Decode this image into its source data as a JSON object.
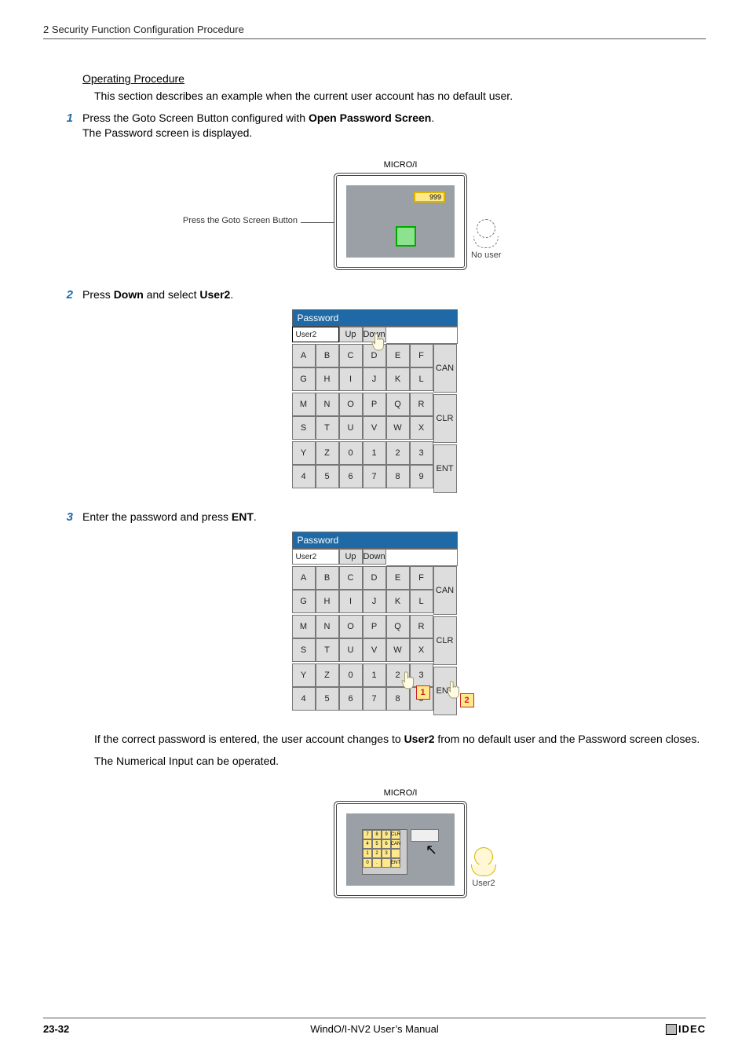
{
  "header": {
    "chapter_line": "2 Security Function Configuration Procedure"
  },
  "section": {
    "title": "Operating Procedure",
    "intro": "This section describes an example when the current user account has no default user."
  },
  "steps": {
    "s1": {
      "num": "1",
      "line1_a": "Press the Goto Screen Button configured with ",
      "line1_b": "Open Password Screen",
      "line1_c": ".",
      "line2": "The Password screen is displayed."
    },
    "s2": {
      "num": "2",
      "a": "Press ",
      "b": "Down",
      "c": " and select ",
      "d": "User2",
      "e": "."
    },
    "s3": {
      "num": "3",
      "a": "Enter the password and press ",
      "b": "ENT",
      "c": "."
    }
  },
  "fig1": {
    "device_label": "MICRO/I",
    "display_value": "999",
    "goto_caption": "Press the Goto Screen Button",
    "no_user_caption": "No user"
  },
  "keypad": {
    "title": "Password",
    "user_field": "User2",
    "up": "Up",
    "down": "Down",
    "rows": [
      [
        "A",
        "B",
        "C",
        "D",
        "E",
        "F"
      ],
      [
        "G",
        "H",
        "I",
        "J",
        "K",
        "L"
      ],
      [
        "M",
        "N",
        "O",
        "P",
        "Q",
        "R"
      ],
      [
        "S",
        "T",
        "U",
        "V",
        "W",
        "X"
      ],
      [
        "Y",
        "Z",
        "0",
        "1",
        "2",
        "3"
      ],
      [
        "4",
        "5",
        "6",
        "7",
        "8",
        "9"
      ]
    ],
    "side": [
      "CAN",
      "CLR",
      "ENT"
    ]
  },
  "after3": {
    "p1_a": "If the correct password is entered, the user account changes to ",
    "p1_b": "User2",
    "p1_c": " from no default user and the Password screen closes.",
    "p2": "The Numerical Input can be operated."
  },
  "fig2": {
    "device_label": "MICRO/I",
    "user2_caption": "User2",
    "mini_rows": [
      [
        "7",
        "8",
        "9",
        "CLR"
      ],
      [
        "4",
        "5",
        "6",
        "CAN"
      ],
      [
        "1",
        "2",
        "3",
        ""
      ],
      [
        "0",
        ".",
        "",
        "ENT"
      ]
    ]
  },
  "callouts": {
    "one": "1",
    "two": "2"
  },
  "footer": {
    "page": "23-32",
    "center": "WindO/I-NV2 User’s Manual",
    "brand": "IDEC"
  }
}
